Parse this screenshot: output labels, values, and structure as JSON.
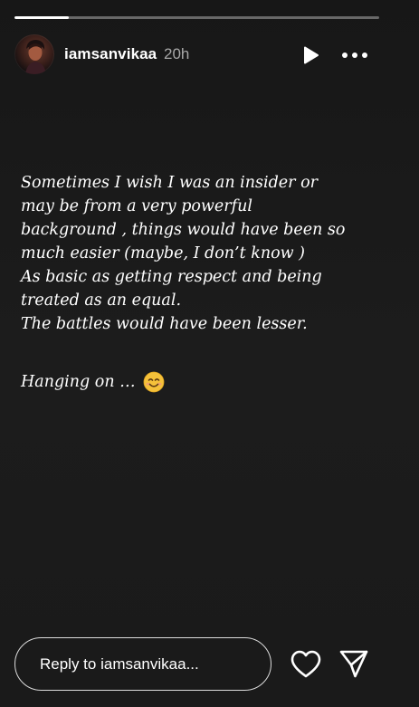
{
  "story": {
    "progress": 0.15,
    "user": {
      "username": "iamsanvikaa",
      "time_ago": "20h",
      "avatar_icon": "profile-photo"
    },
    "controls": {
      "play_icon": "play-icon",
      "more_icon": "more-options-icon"
    },
    "text_lines": [
      "Sometimes I wish I was an insider or",
      "may be from a very powerful",
      "background , things would have been so",
      "much easier (maybe, I don’t know )",
      "As basic as getting respect and being",
      "treated as an equal.",
      "The battles would have been lesser."
    ],
    "closing_line": "Hanging on …",
    "closing_emoji": "smiling-face-emoji"
  },
  "reply": {
    "placeholder": "Reply to iamsanvikaa..."
  },
  "actions": {
    "like_icon": "heart-icon",
    "send_icon": "send-icon"
  },
  "colors": {
    "background": "#1b1b1b",
    "text": "#ffffff",
    "muted": "#a8a8a8",
    "emoji": "#f5c13a"
  }
}
